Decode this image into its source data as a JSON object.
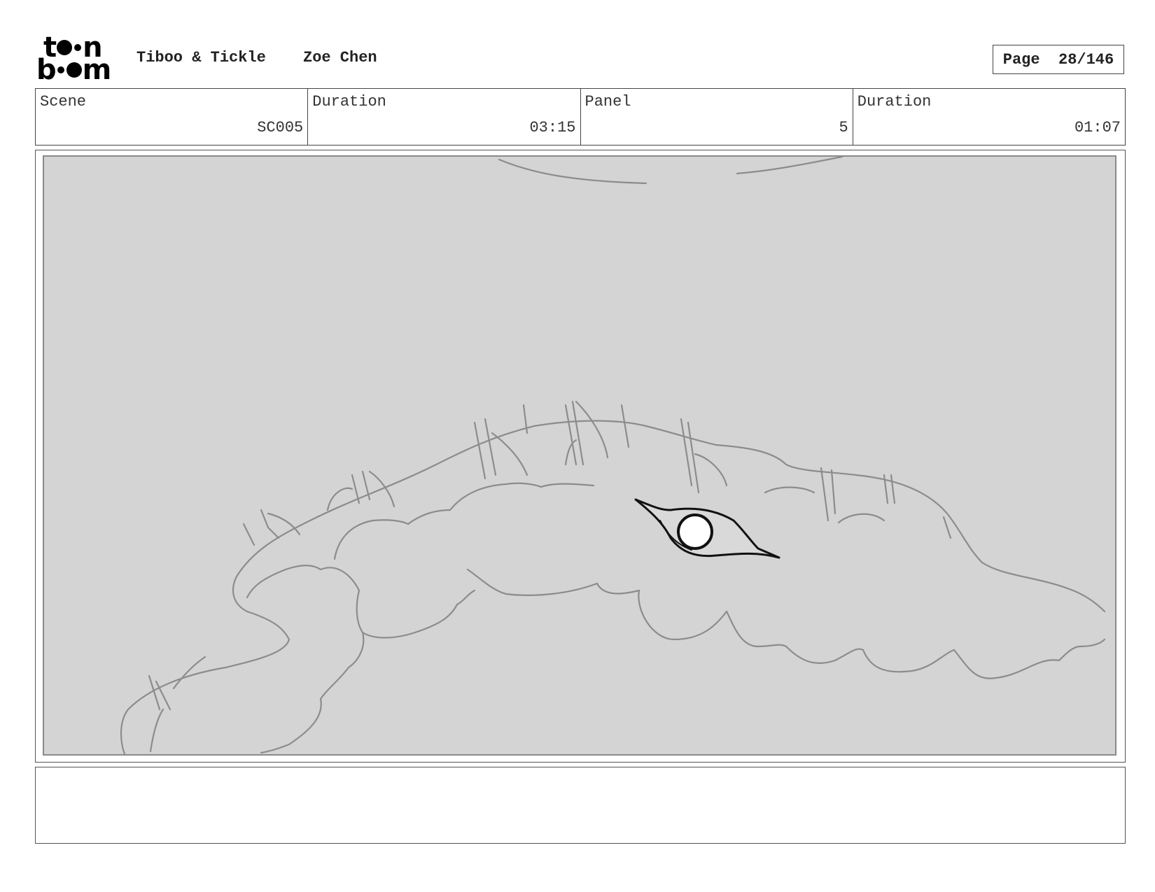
{
  "header": {
    "logo_row1": "t n",
    "logo_row2": "b m",
    "project_title": "Tiboo & Tickle",
    "author": "Zoe Chen",
    "page_label": "Page",
    "page_value": "28/146"
  },
  "info": {
    "scene_label": "Scene",
    "scene_value": "SC005",
    "scene_duration_label": "Duration",
    "scene_duration_value": "03:15",
    "panel_label": "Panel",
    "panel_value": "5",
    "panel_duration_label": "Duration",
    "panel_duration_value": "01:07"
  },
  "panel": {
    "background_color": "#d4d4d4",
    "sketch_color": "#8c8c8c",
    "eye_color": "#111111"
  },
  "notes": {
    "text": ""
  }
}
